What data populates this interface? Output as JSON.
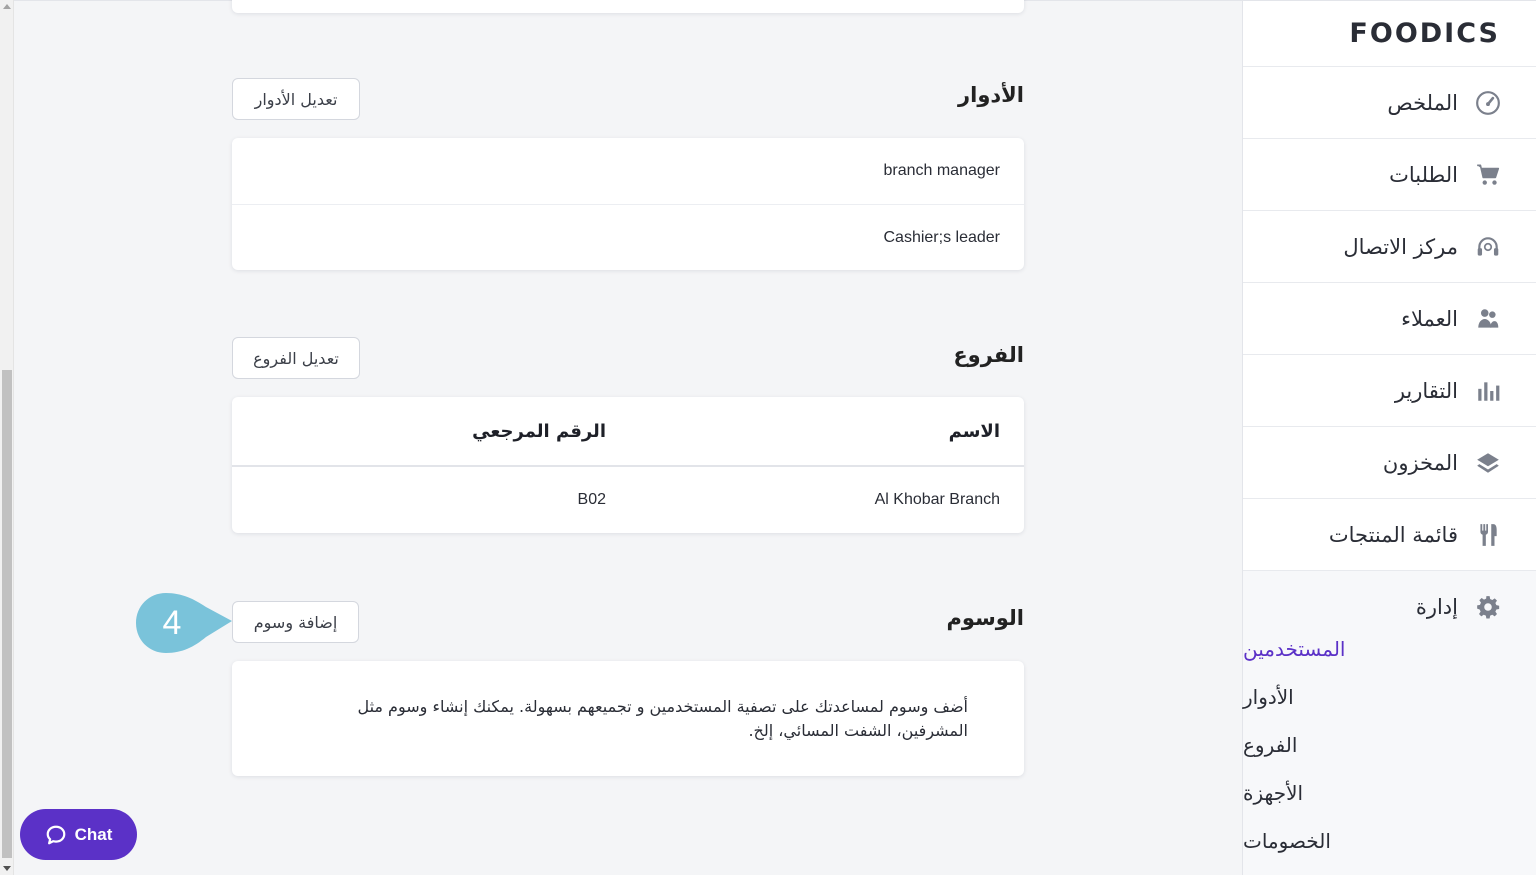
{
  "sidebar": {
    "logo": "FOODICS",
    "nav": [
      {
        "label": "الملخص",
        "icon": "dashboard-gauge-icon"
      },
      {
        "label": "الطلبات",
        "icon": "cart-icon"
      },
      {
        "label": "مركز الاتصال",
        "icon": "headset-icon"
      },
      {
        "label": "العملاء",
        "icon": "customers-icon"
      },
      {
        "label": "التقارير",
        "icon": "bar-chart-icon"
      },
      {
        "label": "المخزون",
        "icon": "layers-icon"
      },
      {
        "label": "قائمة المنتجات",
        "icon": "fork-knife-icon"
      }
    ],
    "admin": {
      "label": "إدارة",
      "icon": "gear-icon",
      "items": [
        {
          "label": "المستخدمين",
          "active": true
        },
        {
          "label": "الأدوار"
        },
        {
          "label": "الفروع"
        },
        {
          "label": "الأجهزة"
        },
        {
          "label": "الخصومات"
        }
      ]
    }
  },
  "roles": {
    "title": "الأدوار",
    "edit_button": "تعديل الأدوار",
    "items": [
      "branch manager",
      "Cashier;s leader"
    ]
  },
  "branches": {
    "title": "الفروع",
    "edit_button": "تعديل الفروع",
    "columns": {
      "name": "الاسم",
      "reference": "الرقم المرجعي"
    },
    "rows": [
      {
        "name": "Al Khobar Branch",
        "reference": "B02"
      }
    ]
  },
  "tags": {
    "title": "الوسوم",
    "add_button": "إضافة وسوم",
    "description": "أضف وسوم لمساعدتك على تصفية المستخدمين و تجميعهم بسهولة. يمكنك إنشاء وسوم مثل المشرفين، الشفت المسائي، إلخ."
  },
  "step_marker": "4",
  "chat": {
    "label": "Chat"
  },
  "colors": {
    "accent": "#5b31c7",
    "step": "#7ac3da"
  }
}
